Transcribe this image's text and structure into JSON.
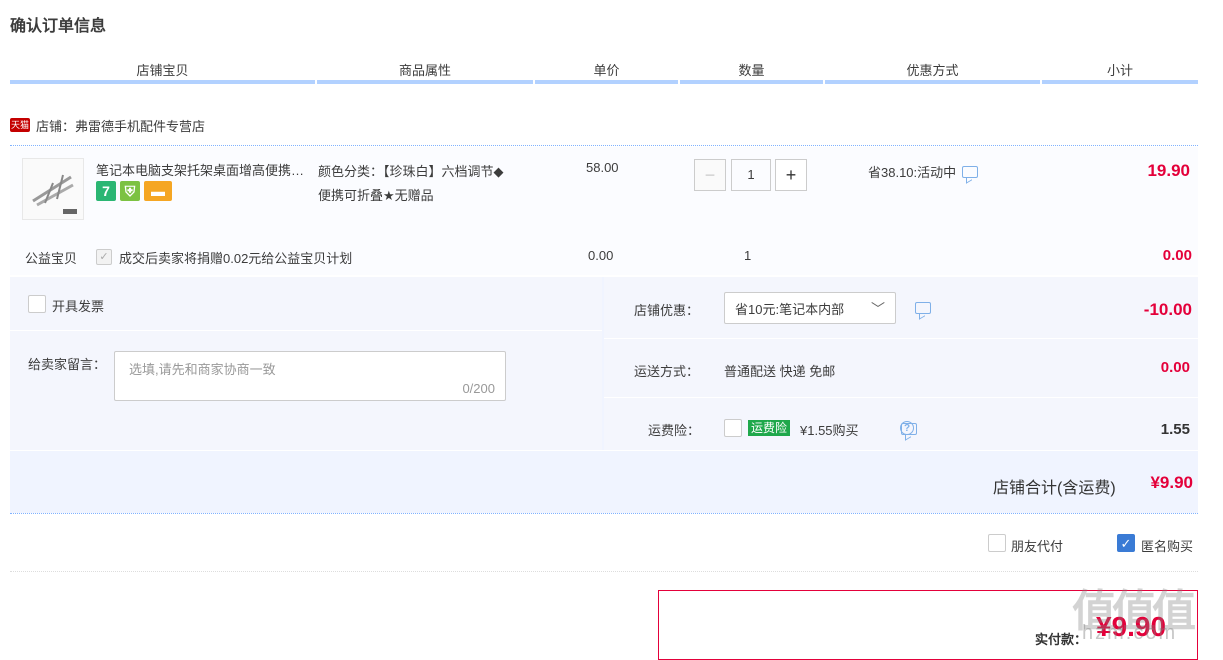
{
  "page_title": "确认订单信息",
  "columns": [
    "店铺宝贝",
    "商品属性",
    "单价",
    "数量",
    "优惠方式",
    "小计"
  ],
  "shop": {
    "badge": "天猫",
    "label": "店铺：弗雷德手机配件专营店"
  },
  "item": {
    "title": "笔记本电脑支架托架桌面增高便携可折叠",
    "attr_line1": "颜色分类：【珍珠白】六档调节◆",
    "attr_line2": "便携可折叠★无赠品",
    "unit_price": "58.00",
    "quantity": "1",
    "minus": "−",
    "plus": "+",
    "promo": "省38.10:活动中",
    "subtotal": "19.90",
    "badge_7": "7"
  },
  "charity": {
    "label": "公益宝贝",
    "text": "成交后卖家将捐赠0.02元给公益宝贝计划",
    "price": "0.00",
    "qty": "1",
    "subtotal": "0.00"
  },
  "invoice_label": "开具发票",
  "message": {
    "label": "给卖家留言：",
    "placeholder": "选填,请先和商家协商一致",
    "counter": "0/200"
  },
  "shop_discount": {
    "label": "店铺优惠：",
    "selected": "省10元:笔记本内部",
    "amount": "-10.00"
  },
  "delivery": {
    "label": "运送方式：",
    "value": "普通配送 快递 免邮",
    "amount": "0.00"
  },
  "insurance": {
    "label": "运费险：",
    "tag": "运费险",
    "price_text": "¥1.55购买",
    "amount": "1.55"
  },
  "shop_total": {
    "label": "店铺合计(含运费)",
    "amount": "¥9.90"
  },
  "options": {
    "friend_pay": "朋友代付",
    "anonymous": "匿名购买"
  },
  "pay": {
    "label": "实付款：",
    "amount": "¥9.90"
  },
  "watermark": {
    "big": "值值值",
    "small": "hzm.com"
  },
  "colors": {
    "accent_red": "#e4003a",
    "header_line": "#b2d1ff",
    "tmall_red": "#c40000",
    "check_blue": "#3a7bd5"
  }
}
